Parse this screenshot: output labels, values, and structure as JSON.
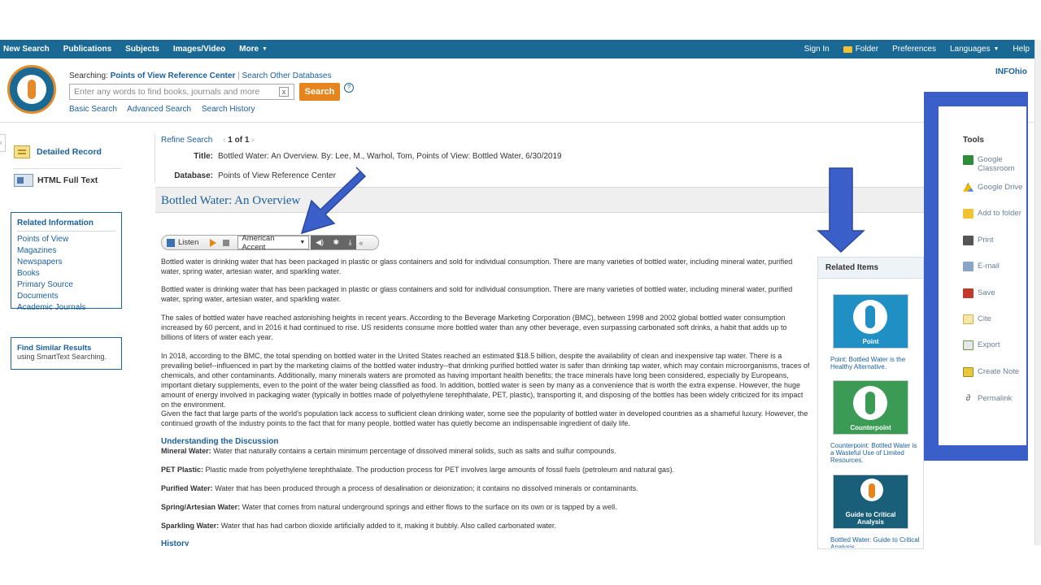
{
  "nav": {
    "left": [
      {
        "label": "New Search"
      },
      {
        "label": "Publications"
      },
      {
        "label": "Subjects"
      },
      {
        "label": "Images/Video"
      },
      {
        "label": "More"
      }
    ],
    "right": {
      "sign_in": "Sign In",
      "folder": "Folder",
      "preferences": "Preferences",
      "languages": "Languages",
      "help": "Help"
    }
  },
  "header": {
    "searching_prefix": "Searching:",
    "database": "Points of View Reference Center",
    "separator": "|",
    "search_other": "Search Other Databases",
    "search_placeholder": "Enter any words to find books, journals and more",
    "search_button": "Search",
    "help_glyph": "?",
    "clear_glyph": "x",
    "links": [
      "Basic Search",
      "Advanced Search",
      "Search History"
    ],
    "institution": "INFOhio"
  },
  "left_nav": {
    "detailed_record": "Detailed Record",
    "html_full_text": "HTML Full Text",
    "related_info": {
      "title": "Related Information",
      "items": [
        "Points of View",
        "Magazines",
        "Newspapers",
        "Books",
        "Primary Source Documents",
        "Academic Journals"
      ]
    },
    "find_similar": {
      "title": "Find Similar Results",
      "subtitle": "using SmartText Searching."
    }
  },
  "record": {
    "refine": "Refine Search",
    "pager": "1 of 1",
    "title_label": "Title:",
    "title_value": "Bottled Water: An Overview. By: Lee, M., Warhol, Tom, Points of View: Bottled Water, 6/30/2019",
    "database_label": "Database:",
    "database_value": "Points of View Reference Center",
    "heading": "Bottled Water: An Overview"
  },
  "listen": {
    "label": "Listen",
    "accent": "American Accent"
  },
  "article": {
    "paragraphs": [
      "Bottled water is drinking water that has been packaged in plastic or glass containers and sold for individual consumption. There are many varieties of bottled water, including mineral water, purified water, spring water, artesian water, and sparkling water.",
      "Bottled water is drinking water that has been packaged in plastic or glass containers and sold for individual consumption. There are many varieties of bottled water, including mineral water, purified water, spring water, artesian water, and sparkling water.",
      "The sales of bottled water have reached astonishing heights in recent years. According to the Beverage Marketing Corporation (BMC), between 1998 and 2002 global bottled water consumption increased by 60 percent, and in 2016 it had continued to rise. US residents consume more bottled water than any other beverage, even surpassing carbonated soft drinks, a habit that adds up to billions of liters of water each year.",
      "In 2018, according to the BMC, the total spending on bottled water in the United States reached an estimated $18.5 billion, despite the availability of clean and inexpensive tap water. There is a prevailing belief--influenced in part by the marketing claims of the bottled water industry--that drinking purified bottled water is safer than drinking tap water, which may contain microorganisms, traces of chemicals, and other contaminants. Additionally, many minerals waters are promoted as having important health benefits; the trace minerals have long been considered, especially by Europeans, important dietary supplements, even to the point of the water being classified as food. In addition, bottled water is seen by many as a convenience that is worth the extra expense. However, the huge amount of energy involved in packaging water (typically in bottles made of polyethylene terephthalate, PET, plastic), transporting it, and disposing of the bottles has been widely criticized for its impact on the environment.",
      "Given the fact that large parts of the world's population lack access to sufficient clean drinking water, some see the popularity of bottled water in developed countries as a shameful luxury. However, the continued growth of the industry points to the fact that for many people, bottled water has quietly become an indispensable ingredient of daily life."
    ],
    "section_heading": "Understanding the Discussion",
    "glossary": [
      {
        "term": "Mineral Water:",
        "def": "Water that naturally contains a certain minimum percentage of dissolved mineral solids, such as salts and sulfur compounds."
      },
      {
        "term": "PET Plastic:",
        "def": "Plastic made from polyethylene terephthalate. The production process for PET involves large amounts of fossil fuels (petroleum and natural gas)."
      },
      {
        "term": "Purified Water:",
        "def": "Water that has been produced through a process of desalination or deionization; it contains no dissolved minerals or contaminants."
      },
      {
        "term": "Spring/Artesian Water:",
        "def": "Water that comes from natural underground springs and either flows to the surface on its own or is tapped by a well."
      },
      {
        "term": "Sparkling Water:",
        "def": "Water that has had carbon dioxide artificially added to it, making it bubbly. Also called carbonated water."
      }
    ],
    "next_heading": "History"
  },
  "related_items": {
    "title": "Related Items",
    "items": [
      {
        "image_label": "Point",
        "caption": "Point: Bottled Water is the Healthy Alternative.",
        "color": "#1f8fc4"
      },
      {
        "image_label": "Counterpoint",
        "caption": "Counterpoint: Bottled Water is a Wasteful Use of Limited Resources.",
        "color": "#3b9b55"
      },
      {
        "image_label": "Guide to Critical Analysis",
        "caption": "Bottled Water: Guide to Critical Analysis",
        "color": "#1a5f7a"
      }
    ]
  },
  "tools": {
    "title": "Tools",
    "items": [
      {
        "label": "Google Classroom",
        "icon": "google-classroom-icon",
        "color": "#2e8b3a"
      },
      {
        "label": "Google Drive",
        "icon": "google-drive-icon",
        "color": "#f4b400"
      },
      {
        "label": "Add to folder",
        "icon": "folder-icon",
        "color": "#f2c230"
      },
      {
        "label": "Print",
        "icon": "printer-icon",
        "color": "#555555"
      },
      {
        "label": "E-mail",
        "icon": "email-icon",
        "color": "#8aa4c8"
      },
      {
        "label": "Save",
        "icon": "save-icon",
        "color": "#c0392b"
      },
      {
        "label": "Cite",
        "icon": "cite-icon",
        "color": "#e7c75c"
      },
      {
        "label": "Export",
        "icon": "export-icon",
        "color": "#6a9a4a"
      },
      {
        "label": "Create Note",
        "icon": "note-icon",
        "color": "#e8c93a"
      },
      {
        "label": "Permalink",
        "icon": "link-icon",
        "color": "#555555"
      }
    ]
  },
  "colors": {
    "nav_bar": "#1a6894",
    "link": "#1a5f9e",
    "search_button": "#e6841e",
    "annotation": "#3b5fc8"
  }
}
